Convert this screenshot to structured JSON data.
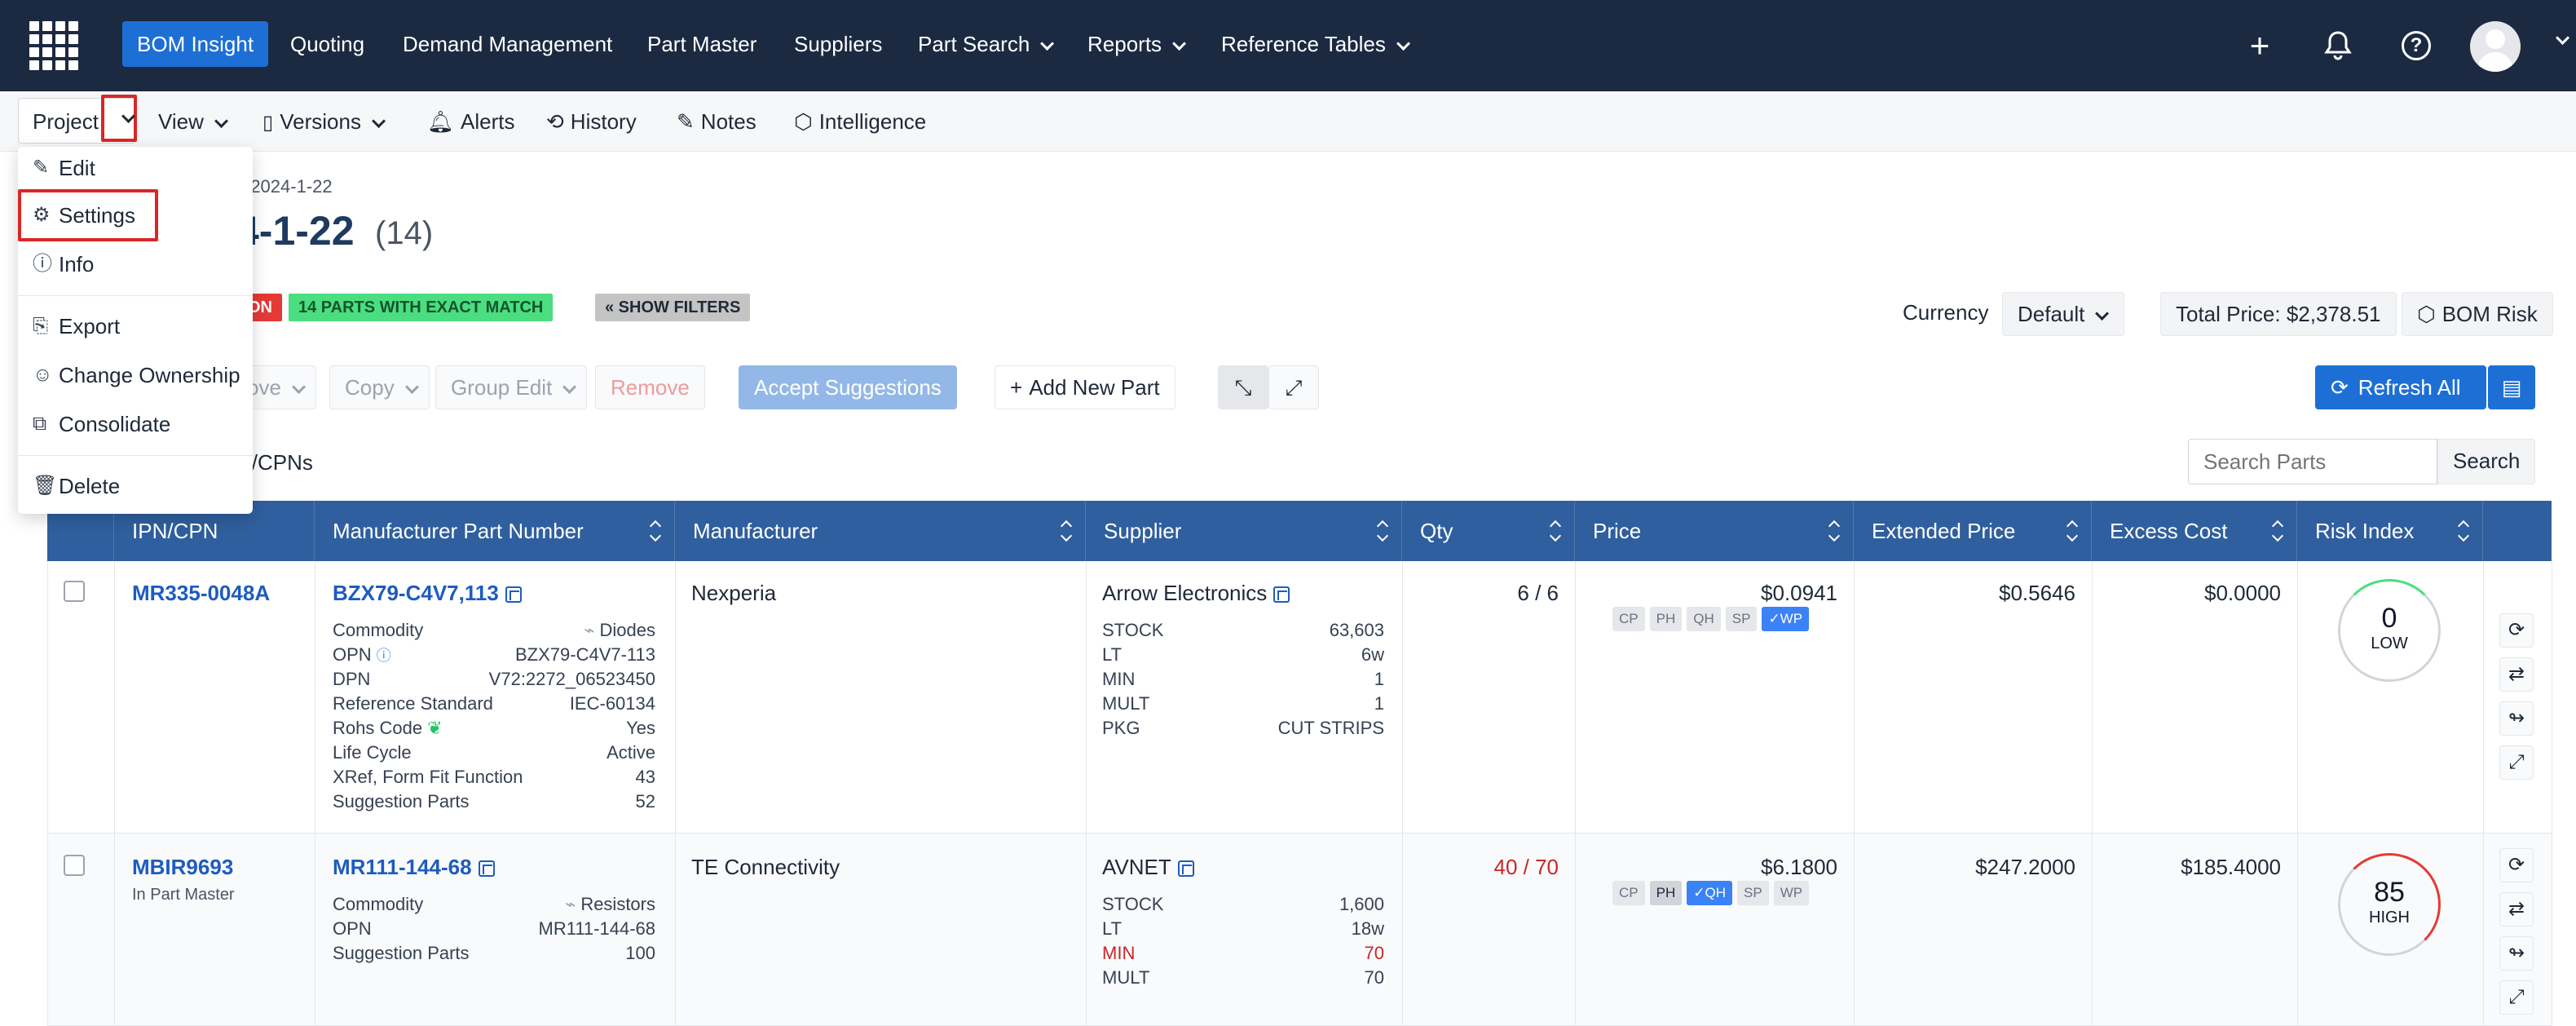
{
  "nav": {
    "brand_label": "BOM Insight",
    "items": [
      "Quoting",
      "Demand Management",
      "Part Master",
      "Suppliers",
      "Part Search",
      "Reports",
      "Reference Tables"
    ]
  },
  "toolbar": {
    "project": "Project",
    "view": "View",
    "versions": "Versions",
    "alerts": "Alerts",
    "history": "History",
    "notes": "Notes",
    "intelligence": "Intelligence"
  },
  "menu": {
    "items": [
      "Edit",
      "Settings",
      "Info",
      "Export",
      "Change Ownership",
      "Consolidate",
      "Delete"
    ]
  },
  "page": {
    "breadcrumb_tail": "-2024-1-22",
    "title_tail": "4-1-22",
    "count": "(14)",
    "badge_red": "ON",
    "badge_green": "14 PARTS WITH EXACT MATCH",
    "show_filters": "« SHOW FILTERS",
    "currency_label": "Currency",
    "currency_value": "Default",
    "total_price": "Total Price: $2,378.51",
    "bom_risk": "BOM Risk"
  },
  "actions": {
    "move": "ove",
    "copy": "Copy",
    "group_edit": "Group Edit",
    "remove": "Remove",
    "accept": "Accept Suggestions",
    "add_part": "Add New Part",
    "refresh_all": "Refresh All",
    "ipn_filter": "N/CPNs",
    "search_placeholder": "Search Parts",
    "search_button": "Search"
  },
  "table": {
    "headers": [
      "IPN/CPN",
      "Manufacturer Part Number",
      "Manufacturer",
      "Supplier",
      "Qty",
      "Price",
      "Extended Price",
      "Excess Cost",
      "Risk Index"
    ],
    "rows": [
      {
        "ipn": "MR335-0048A",
        "ipn_sub": "",
        "mpn": "BZX79-C4V7,113",
        "mpn_details": [
          [
            "Commodity",
            "Diodes"
          ],
          [
            "OPN",
            "BZX79-C4V7-113"
          ],
          [
            "DPN",
            "V72:2272_06523450"
          ],
          [
            "Reference Standard",
            "IEC-60134"
          ],
          [
            "Rohs Code",
            "Yes"
          ],
          [
            "Life Cycle",
            "Active"
          ],
          [
            "XRef, Form Fit Function",
            "43"
          ],
          [
            "Suggestion Parts",
            "52"
          ]
        ],
        "manufacturer": "Nexperia",
        "supplier": "Arrow Electronics",
        "supplier_details": [
          [
            "STOCK",
            "63,603"
          ],
          [
            "LT",
            "6w"
          ],
          [
            "MIN",
            "1"
          ],
          [
            "MULT",
            "1"
          ],
          [
            "PKG",
            "CUT STRIPS"
          ]
        ],
        "qty": "6 / 6",
        "price": "$0.0941",
        "price_chips": [
          "CP",
          "PH",
          "QH",
          "SP",
          "✓WP"
        ],
        "extended": "$0.5646",
        "excess": "$0.0000",
        "risk_value": "0",
        "risk_label": "LOW"
      },
      {
        "ipn": "MBIR9693",
        "ipn_sub": "In Part Master",
        "mpn": "MR111-144-68",
        "mpn_details": [
          [
            "Commodity",
            "Resistors"
          ],
          [
            "OPN",
            "MR111-144-68"
          ],
          [
            "Suggestion Parts",
            "100"
          ]
        ],
        "manufacturer": "TE Connectivity",
        "supplier": "AVNET",
        "supplier_details": [
          [
            "STOCK",
            "1,600"
          ],
          [
            "LT",
            "18w"
          ],
          [
            "MIN",
            "70"
          ],
          [
            "MULT",
            "70"
          ]
        ],
        "qty": "40 / 70",
        "price": "$6.1800",
        "price_chips": [
          "CP",
          "PH",
          "✓QH",
          "SP",
          "WP"
        ],
        "extended": "$247.2000",
        "excess": "$185.4000",
        "risk_value": "85",
        "risk_label": "HIGH"
      }
    ]
  },
  "colors": {
    "nav_bg": "#1b2a41",
    "accent": "#1d6fd6",
    "header_bg": "#2f5f9e",
    "highlight": "#dc2626"
  }
}
